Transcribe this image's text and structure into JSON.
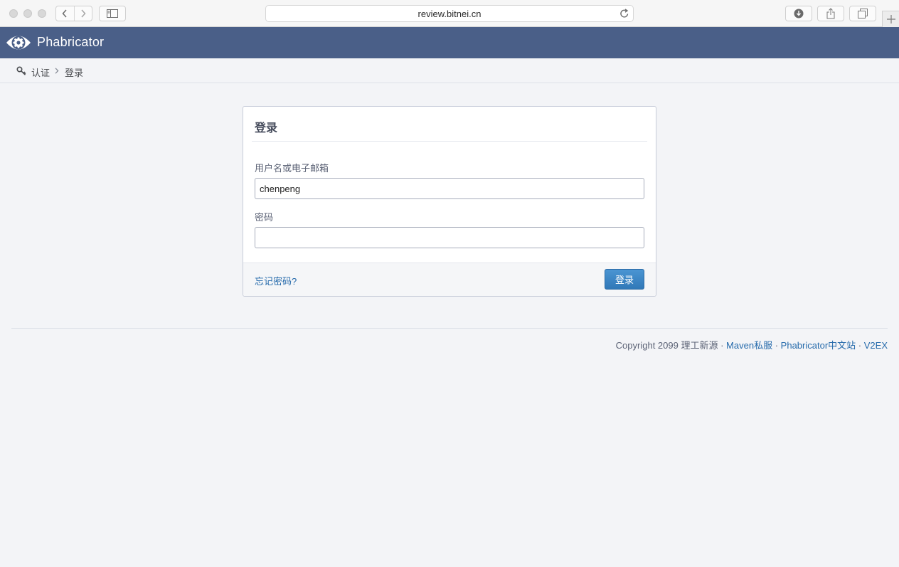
{
  "browser": {
    "url": "review.bitnei.cn"
  },
  "header": {
    "brand": "Phabricator"
  },
  "breadcrumb": {
    "items": [
      "认证",
      "登录"
    ]
  },
  "login_form": {
    "title": "登录",
    "username_label": "用户名或电子邮箱",
    "username_value": "chenpeng",
    "password_label": "密码",
    "password_value": "",
    "forgot_link": "忘记密码?",
    "submit_label": "登录"
  },
  "footer": {
    "copyright": "Copyright 2099 理工新源",
    "sep": "·",
    "links": [
      "Maven私服",
      "Phabricator中文站",
      "V2EX"
    ]
  },
  "colors": {
    "header_bg": "#4a5f88",
    "link": "#256aab",
    "button": "#3d87c7"
  },
  "icons": [
    "back-icon",
    "forward-icon",
    "sidebar-icon",
    "reload-icon",
    "download-icon",
    "share-icon",
    "tabs-icon",
    "new-tab-icon",
    "phabricator-logo-icon",
    "key-icon"
  ]
}
